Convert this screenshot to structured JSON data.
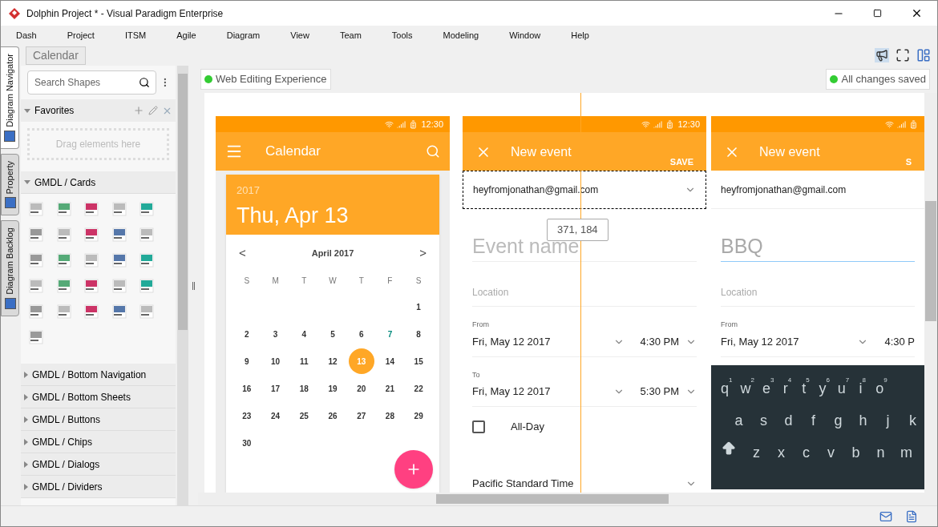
{
  "window": {
    "title": "Dolphin Project * - Visual Paradigm Enterprise"
  },
  "menu": [
    "Dash",
    "Project",
    "ITSM",
    "Agile",
    "Diagram",
    "View",
    "Team",
    "Tools",
    "Modeling",
    "Window",
    "Help"
  ],
  "side_tabs": [
    {
      "label": "Diagram Navigator",
      "selected": true
    },
    {
      "label": "Property",
      "selected": false
    },
    {
      "label": "Diagram Backlog",
      "selected": false
    }
  ],
  "breadcrumb": "Calendar",
  "shapes_panel": {
    "search": {
      "placeholder": "Search Shapes"
    },
    "favorites": {
      "title": "Favorites",
      "expanded": true,
      "drop_hint": "Drag elements here"
    },
    "groups": [
      {
        "title": "GMDL / Cards",
        "expanded": true
      },
      {
        "title": "GMDL / Bottom Navigation",
        "expanded": false
      },
      {
        "title": "GMDL / Bottom Sheets",
        "expanded": false
      },
      {
        "title": "GMDL / Buttons",
        "expanded": false
      },
      {
        "title": "GMDL / Chips",
        "expanded": false
      },
      {
        "title": "GMDL / Dialogs",
        "expanded": false
      },
      {
        "title": "GMDL / Dividers",
        "expanded": false
      }
    ]
  },
  "canvas": {
    "left_status": "Web Editing Experience",
    "right_status": "All changes saved",
    "coordinates": "371, 184",
    "phone_calendar": {
      "time": "12:30",
      "title": "Calendar",
      "year": "2017",
      "date": "Thu, Apr 13",
      "prev": "<",
      "next": ">",
      "month": "April 2017",
      "weekdays": [
        "S",
        "M",
        "T",
        "W",
        "T",
        "F",
        "S"
      ],
      "weeks": [
        {
          "kind": "partial_start",
          "days": [
            {
              "label": "1",
              "selected": false,
              "today": false
            }
          ]
        },
        {
          "kind": "full",
          "days": [
            {
              "label": "2",
              "selected": false,
              "today": false
            },
            {
              "label": "3",
              "selected": false,
              "today": false
            },
            {
              "label": "4",
              "selected": false,
              "today": false
            },
            {
              "label": "5",
              "selected": false,
              "today": false
            },
            {
              "label": "6",
              "selected": false,
              "today": false
            },
            {
              "label": "7",
              "selected": false,
              "today": true
            },
            {
              "label": "8",
              "selected": false,
              "today": false
            }
          ]
        },
        {
          "kind": "full",
          "days": [
            {
              "label": "9",
              "selected": false,
              "today": false
            },
            {
              "label": "10",
              "selected": false,
              "today": false
            },
            {
              "label": "11",
              "selected": false,
              "today": false
            },
            {
              "label": "12",
              "selected": false,
              "today": false
            },
            {
              "label": "13",
              "selected": true,
              "today": false
            },
            {
              "label": "14",
              "selected": false,
              "today": false
            },
            {
              "label": "15",
              "selected": false,
              "today": false
            }
          ]
        },
        {
          "kind": "full",
          "days": [
            {
              "label": "16",
              "selected": false,
              "today": false
            },
            {
              "label": "17",
              "selected": false,
              "today": false
            },
            {
              "label": "18",
              "selected": false,
              "today": false
            },
            {
              "label": "19",
              "selected": false,
              "today": false
            },
            {
              "label": "20",
              "selected": false,
              "today": false
            },
            {
              "label": "21",
              "selected": false,
              "today": false
            },
            {
              "label": "22",
              "selected": false,
              "today": false
            }
          ]
        },
        {
          "kind": "full",
          "days": [
            {
              "label": "23",
              "selected": false,
              "today": false
            },
            {
              "label": "24",
              "selected": false,
              "today": false
            },
            {
              "label": "25",
              "selected": false,
              "today": false
            },
            {
              "label": "26",
              "selected": false,
              "today": false
            },
            {
              "label": "27",
              "selected": false,
              "today": false
            },
            {
              "label": "28",
              "selected": false,
              "today": false
            },
            {
              "label": "29",
              "selected": false,
              "today": false
            }
          ]
        },
        {
          "kind": "full",
          "days": [
            {
              "label": "30",
              "selected": false,
              "today": false
            }
          ]
        }
      ]
    },
    "phone_event": {
      "time": "12:30",
      "title": "New event",
      "save": "SAVE",
      "account": "heyfromjonathan@gmail.com",
      "account_selected": true,
      "event_name": {
        "placeholder": "Event name"
      },
      "location": {
        "placeholder": "Location"
      },
      "from_label": "From",
      "from_date": "Fri, May 12 2017",
      "from_time": "4:30 PM",
      "to_label": "To",
      "to_date": "Fri, May 12 2017",
      "to_time": "5:30 PM",
      "all_day": {
        "label": "All-Day",
        "checked": false
      },
      "timezone": "Pacific Standard Time"
    },
    "phone_event_filled": {
      "title": "New event",
      "save": "S",
      "account": "heyfromjonathan@gmail.com",
      "event_name": {
        "value": "BBQ"
      },
      "location": {
        "placeholder": "Location"
      },
      "from_label": "From",
      "from_date": "Fri, May 12 2017",
      "from_time": "4:30 P",
      "keyboard": [
        [
          {
            "key": "q",
            "hint": "1"
          },
          {
            "key": "w",
            "hint": "2"
          },
          {
            "key": "e",
            "hint": "3"
          },
          {
            "key": "r",
            "hint": "4"
          },
          {
            "key": "t",
            "hint": "5"
          },
          {
            "key": "y",
            "hint": "6"
          },
          {
            "key": "u",
            "hint": "7"
          },
          {
            "key": "i",
            "hint": "8"
          },
          {
            "key": "o",
            "hint": "9"
          }
        ],
        [
          {
            "key": "a"
          },
          {
            "key": "s"
          },
          {
            "key": "d"
          },
          {
            "key": "f"
          },
          {
            "key": "g"
          },
          {
            "key": "h"
          },
          {
            "key": "j"
          },
          {
            "key": "k"
          }
        ],
        [
          {
            "key": "z"
          },
          {
            "key": "x"
          },
          {
            "key": "c"
          },
          {
            "key": "v"
          },
          {
            "key": "b"
          },
          {
            "key": "n"
          },
          {
            "key": "m"
          }
        ]
      ]
    }
  }
}
